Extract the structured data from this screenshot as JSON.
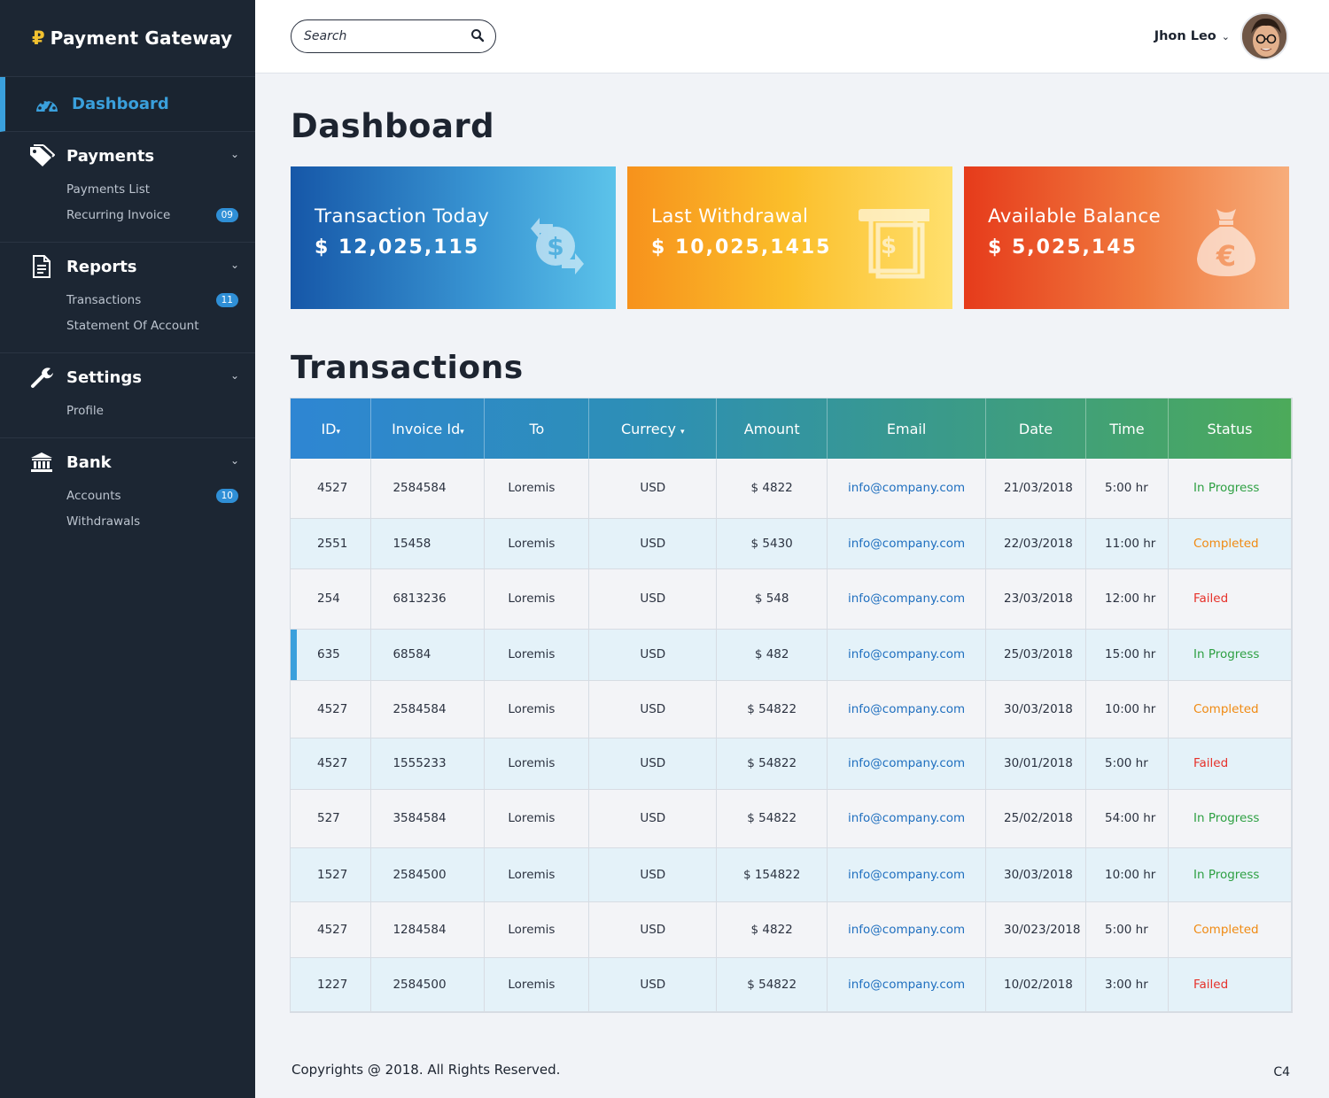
{
  "brand": {
    "logo": "₽",
    "title": "Payment Gateway"
  },
  "sidebar": {
    "dashboard": "Dashboard",
    "groups": [
      {
        "label": "Payments",
        "icon": "tags-icon",
        "items": [
          {
            "label": "Payments List",
            "badge": ""
          },
          {
            "label": "Recurring Invoice",
            "badge": "09"
          }
        ]
      },
      {
        "label": "Reports",
        "icon": "document-icon",
        "items": [
          {
            "label": "Transactions",
            "badge": "11"
          },
          {
            "label": "Statement Of Account",
            "badge": ""
          }
        ]
      },
      {
        "label": "Settings",
        "icon": "wrench-icon",
        "items": [
          {
            "label": "Profile",
            "badge": ""
          }
        ]
      },
      {
        "label": "Bank",
        "icon": "bank-icon",
        "items": [
          {
            "label": "Accounts",
            "badge": "10"
          },
          {
            "label": "Withdrawals",
            "badge": ""
          }
        ]
      }
    ]
  },
  "topbar": {
    "search_placeholder": "Search",
    "user_name": "Jhon Leo"
  },
  "main": {
    "title": "Dashboard",
    "cards": [
      {
        "label": "Transaction Today",
        "value": "$ 12,025,115",
        "icon": "dollar-exchange-icon"
      },
      {
        "label": "Last Withdrawal",
        "value": "$ 10,025,1415",
        "icon": "cash-withdrawal-icon"
      },
      {
        "label": "Available Balance",
        "value": "$ 5,025,145",
        "icon": "euro-money-bag-icon"
      }
    ],
    "transactions_title": "Transactions"
  },
  "table": {
    "headers": [
      "ID",
      "Invoice Id",
      "To",
      "Currecy",
      "Amount",
      "Email",
      "Date",
      "Time",
      "Status"
    ],
    "rows": [
      [
        "4527",
        "2584584",
        "Loremis",
        "USD",
        "$ 4822",
        "info@company.com",
        "21/03/2018",
        "5:00 hr",
        "In Progress"
      ],
      [
        "2551",
        "15458",
        "Loremis",
        "USD",
        "$ 5430",
        "info@company.com",
        "22/03/2018",
        "11:00 hr",
        "Completed"
      ],
      [
        "254",
        "6813236",
        "Loremis",
        "USD",
        "$ 548",
        "info@company.com",
        "23/03/2018",
        "12:00 hr",
        "Failed"
      ],
      [
        "635",
        "68584",
        "Loremis",
        "USD",
        "$ 482",
        "info@company.com",
        "25/03/2018",
        "15:00 hr",
        "In Progress"
      ],
      [
        "4527",
        "2584584",
        "Loremis",
        "USD",
        "$ 54822",
        "info@company.com",
        "30/03/2018",
        "10:00 hr",
        "Completed"
      ],
      [
        "4527",
        "1555233",
        "Loremis",
        "USD",
        "$ 54822",
        "info@company.com",
        "30/01/2018",
        "5:00 hr",
        "Failed"
      ],
      [
        "527",
        "3584584",
        "Loremis",
        "USD",
        "$ 54822",
        "info@company.com",
        "25/02/2018",
        "54:00 hr",
        "In Progress"
      ],
      [
        "1527",
        "2584500",
        "Loremis",
        "USD",
        "$ 154822",
        "info@company.com",
        "30/03/2018",
        "10:00 hr",
        "In Progress"
      ],
      [
        "4527",
        "1284584",
        "Loremis",
        "USD",
        "$ 4822",
        "info@company.com",
        "30/023/2018",
        "5:00 hr",
        "Completed"
      ],
      [
        "1227",
        "2584500",
        "Loremis",
        "USD",
        "$ 54822",
        "info@company.com",
        "10/02/2018",
        "3:00 hr",
        "Failed"
      ]
    ],
    "status_colors": {
      "In Progress": "#2ea043",
      "Completed": "#f08a12",
      "Failed": "#e6312a"
    }
  },
  "footer": {
    "copyright": "Copyrights @ 2018. All Rights Reserved.",
    "corner": "C4"
  }
}
